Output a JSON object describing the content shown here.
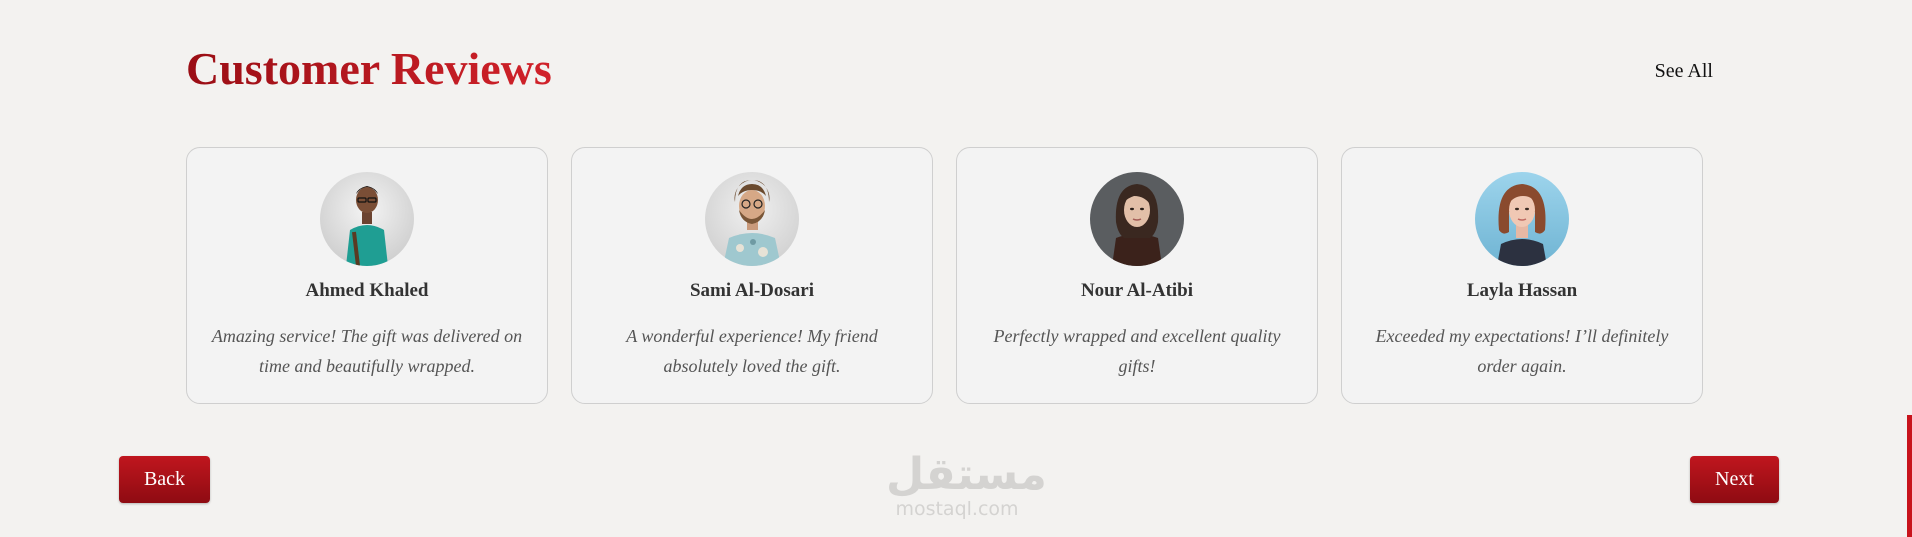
{
  "section": {
    "title": "Customer Reviews",
    "see_all_label": "See All"
  },
  "reviews": [
    {
      "name": "Ahmed Khaled",
      "text": "Amazing service! The gift was delivered on time and beautifully wrapped.",
      "avatar": "avatar-photo"
    },
    {
      "name": "Sami Al-Dosari",
      "text": "A wonderful experience! My friend absolutely loved the gift.",
      "avatar": "avatar-photo"
    },
    {
      "name": "Nour Al-Atibi",
      "text": "Perfectly wrapped and excellent quality gifts!",
      "avatar": "avatar-photo"
    },
    {
      "name": "Layla Hassan",
      "text": "Exceeded my expectations! I’ll definitely order again.",
      "avatar": "avatar-photo"
    }
  ],
  "nav": {
    "back_label": "Back",
    "next_label": "Next"
  },
  "watermark": {
    "arabic": "مستقل",
    "latin": "mostaql.com"
  },
  "colors": {
    "accent": "#b3141c",
    "background": "#f3f2f0"
  }
}
